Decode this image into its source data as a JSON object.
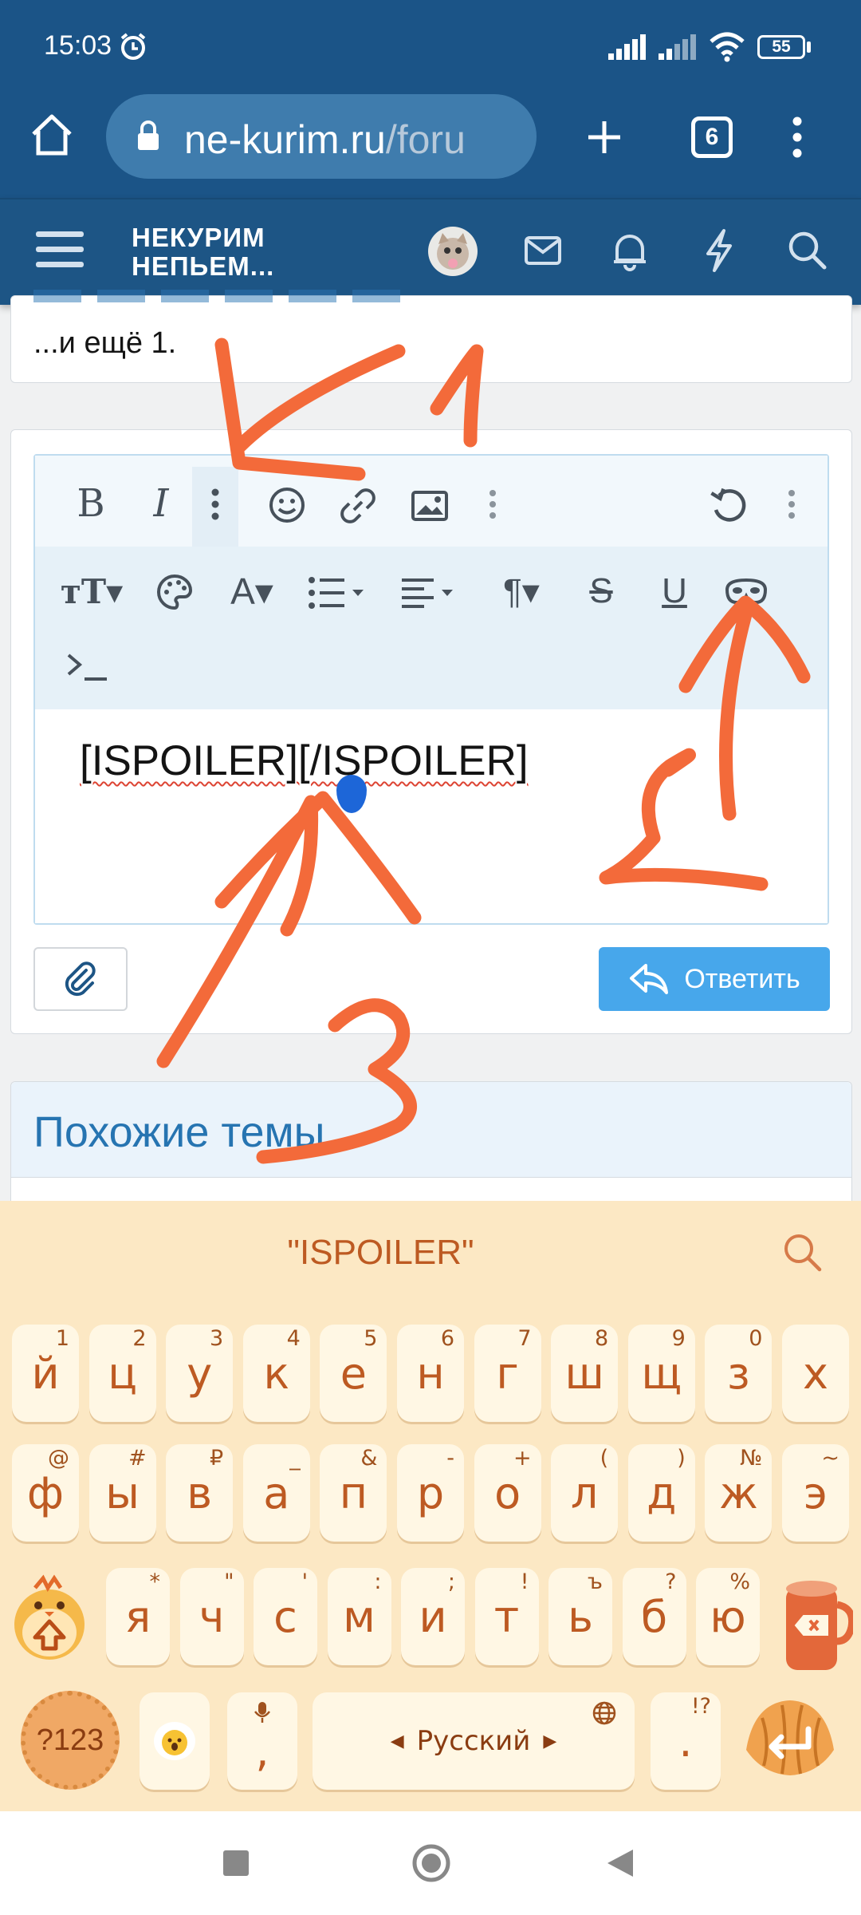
{
  "status": {
    "time": "15:03",
    "battery": "55"
  },
  "browser": {
    "url_host": "ne-kurim.ru",
    "url_path": "/foru",
    "tabs_count": "6"
  },
  "site": {
    "logo_line1": "НЕКУРИМ",
    "logo_line2": "НЕПЬЕМ..."
  },
  "post": {
    "tail_text": "...и ещё 1."
  },
  "editor": {
    "content": "[ISPOILER][/ISPOILER]",
    "reply_label": "Ответить"
  },
  "similar": {
    "title": "Похожие темы"
  },
  "keyboard": {
    "suggestion": "\"ISPOILER\"",
    "row1": [
      {
        "k": "й",
        "h": "1"
      },
      {
        "k": "ц",
        "h": "2"
      },
      {
        "k": "у",
        "h": "3"
      },
      {
        "k": "к",
        "h": "4"
      },
      {
        "k": "е",
        "h": "5"
      },
      {
        "k": "н",
        "h": "6"
      },
      {
        "k": "г",
        "h": "7"
      },
      {
        "k": "ш",
        "h": "8"
      },
      {
        "k": "щ",
        "h": "9"
      },
      {
        "k": "з",
        "h": "0"
      },
      {
        "k": "х",
        "h": ""
      }
    ],
    "row2": [
      {
        "k": "ф",
        "h": "@"
      },
      {
        "k": "ы",
        "h": "#"
      },
      {
        "k": "в",
        "h": "₽"
      },
      {
        "k": "а",
        "h": "_"
      },
      {
        "k": "п",
        "h": "&"
      },
      {
        "k": "р",
        "h": "-"
      },
      {
        "k": "о",
        "h": "+"
      },
      {
        "k": "л",
        "h": "("
      },
      {
        "k": "д",
        "h": ")"
      },
      {
        "k": "ж",
        "h": "№"
      },
      {
        "k": "э",
        "h": "~"
      }
    ],
    "row3": [
      {
        "k": "я",
        "h": "*"
      },
      {
        "k": "ч",
        "h": "\""
      },
      {
        "k": "с",
        "h": "'"
      },
      {
        "k": "м",
        "h": ":"
      },
      {
        "k": "и",
        "h": ";"
      },
      {
        "k": "т",
        "h": "!"
      },
      {
        "k": "ь",
        "h": "ъ"
      },
      {
        "k": "б",
        "h": "?"
      },
      {
        "k": "ю",
        "h": "%"
      }
    ],
    "symbols_label": "?123",
    "comma": ",",
    "space_label": "Русский",
    "period": ".",
    "period_hint": "!?"
  },
  "colors": {
    "accent": "#1b5487",
    "reply_button": "#47a7eb",
    "annotation": "#f36a3a",
    "keyboard_bg": "#fce8c4"
  }
}
